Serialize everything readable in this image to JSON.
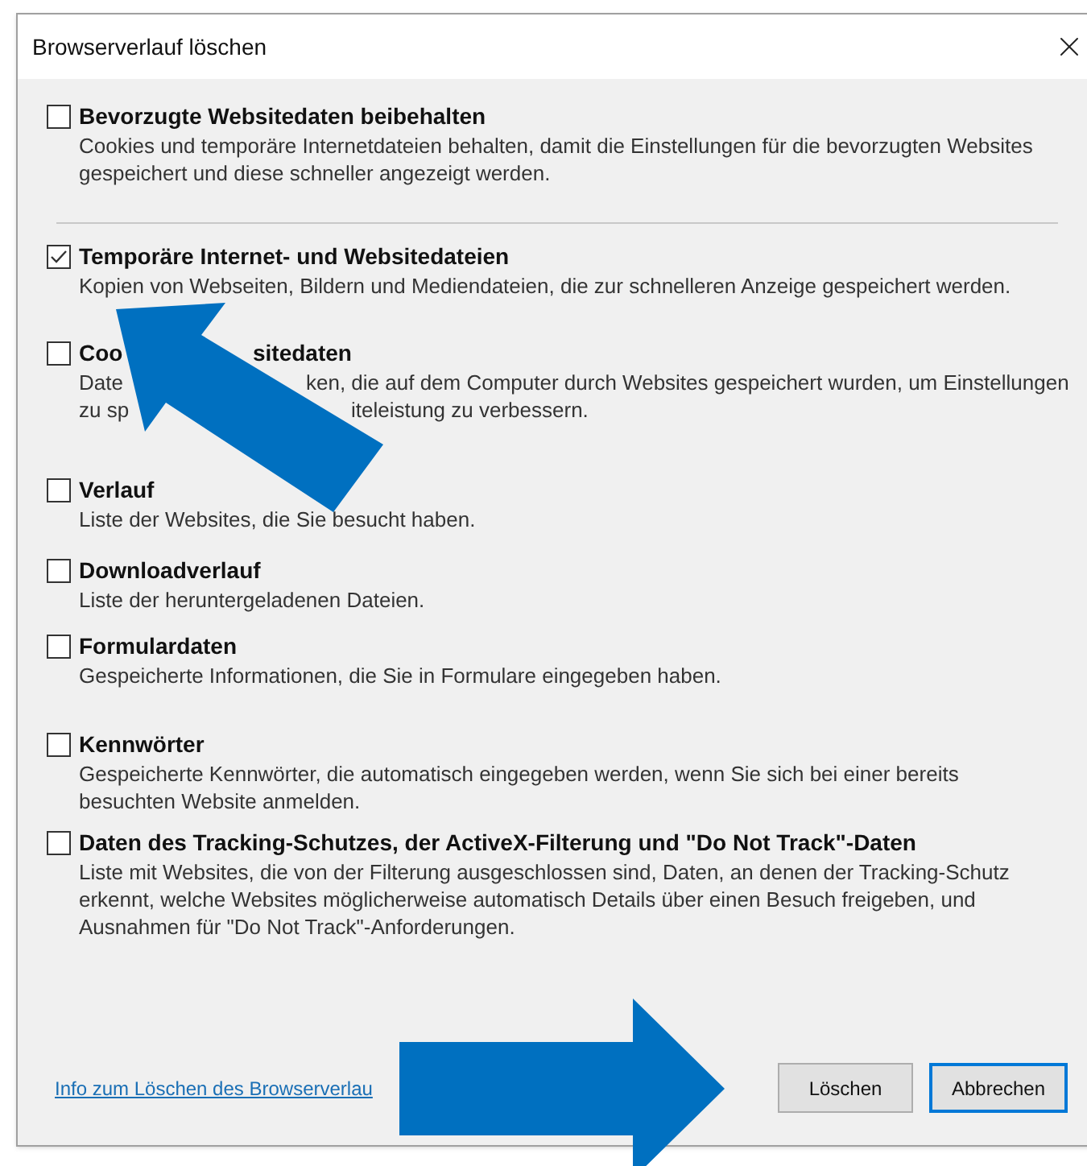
{
  "window": {
    "title": "Browserverlauf löschen"
  },
  "items": [
    {
      "checked": false,
      "divider_after": true,
      "title": [
        "Bevorzugte Websitedaten beibehalten"
      ],
      "lines": [
        [
          "Cookies und temporäre Internetdateien behalten, damit die Einstellungen für die bevorzugten Websites"
        ],
        [
          "gespeichert und diese schneller angezeigt werden."
        ]
      ]
    },
    {
      "checked": true,
      "title": [
        "Temporäre Internet- und Websitedateien"
      ],
      "lines": [
        [
          "Kopien von Webseiten, Bildern und Mediendateien, die zur schnelleren Anzeige gespeichert werden."
        ]
      ]
    },
    {
      "checked": false,
      "title": [
        "Coo",
        "sitedaten"
      ],
      "lines": [
        [
          "Date",
          "ken, die auf dem Computer durch Websites gespeichert wurden, um Einstellungen"
        ],
        [
          "zu sp",
          "iteleistung zu verbessern."
        ]
      ]
    },
    {
      "checked": false,
      "title": [
        "Verlauf"
      ],
      "lines": [
        [
          "Liste der Websites, die Sie besucht haben."
        ]
      ]
    },
    {
      "checked": false,
      "title": [
        "Downloadverlauf"
      ],
      "lines": [
        [
          "Liste der heruntergeladenen Dateien."
        ]
      ]
    },
    {
      "checked": false,
      "title": [
        "Formulardaten"
      ],
      "lines": [
        [
          "Gespeicherte Informationen, die Sie in Formulare eingegeben haben."
        ]
      ]
    },
    {
      "checked": false,
      "title": [
        "Kennwörter"
      ],
      "lines": [
        [
          "Gespeicherte Kennwörter, die automatisch eingegeben werden, wenn Sie sich bei einer bereits"
        ],
        [
          "besuchten Website anmelden."
        ]
      ]
    },
    {
      "checked": false,
      "title": [
        "Daten des Tracking-Schutzes, der ActiveX-Filterung und \"Do Not Track\"-Daten"
      ],
      "lines": [
        [
          "Liste mit Websites, die von der Filterung ausgeschlossen sind, Daten, an denen der Tracking-Schutz"
        ],
        [
          "erkennt, welche Websites möglicherweise automatisch Details über einen Besuch freigeben, und"
        ],
        [
          "Ausnahmen für \"Do Not Track\"-Anforderungen."
        ]
      ]
    }
  ],
  "link": "Info zum Löschen des Browserverlau",
  "buttons": [
    {
      "label": "Löschen",
      "default": false
    },
    {
      "label": "Abbrechen",
      "default": true
    }
  ]
}
